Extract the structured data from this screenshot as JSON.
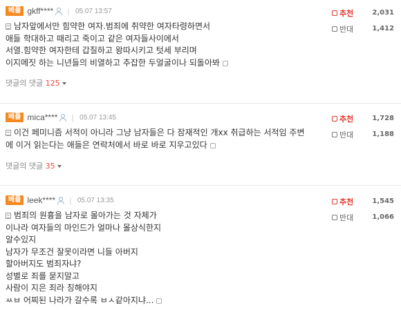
{
  "comments": [
    {
      "badge": "베플",
      "username": "gkff****",
      "date": "05.07 13:57",
      "lines": [
        "남자앞에서만 힘약한 여자.범죄에 취약한 여자타령하면서",
        "애들 학대하고 때리고 죽이고 같은 여자들사이에서",
        "서열.힘약한 여자한테 갑질하고 왕따시키고 텃세 부리며",
        "이지메짓 하는 니년들의 비열하고 추잡한 두얼굴이나 되돌아봐"
      ],
      "reply_label": "댓글의 댓글",
      "reply_count": "125",
      "up_label": "추천",
      "up_count": "2,031",
      "down_label": "반대",
      "down_count": "1,412"
    },
    {
      "badge": "베플",
      "username": "mica****",
      "date": "05.07 13:45",
      "lines": [
        "이건 페미니즘 서적이 아니라 그냥 남자들은 다 잠재적인 개xx 취급하는 서적임 주변",
        "에 이거 읽는다는 애들은 연락처에서 바로 바로 지우고있다"
      ],
      "reply_label": "댓글의 댓글",
      "reply_count": "35",
      "up_label": "추천",
      "up_count": "1,728",
      "down_label": "반대",
      "down_count": "1,188"
    },
    {
      "badge": "베플",
      "username": "leek****",
      "date": "05.07 13:35",
      "lines": [
        "범죄의 원흉을 남자로 몰아가는 것 자체가",
        "이나라 여자들의 마인드가 얼마나 몰상식한지",
        "알수있지",
        "남자가 무조건 잘못이라면 니들 아버지",
        "할아버지도 범죄자냐?",
        "성별로 죄를 묻지말고",
        "사람이 지은 죄라 칭해야지",
        "ㅆㅂ 어찌된 나라가 갈수록 ㅂㅅ같아지냐..."
      ],
      "up_label": "추천",
      "up_count": "1,545",
      "down_label": "반대",
      "down_count": "1,066"
    }
  ]
}
